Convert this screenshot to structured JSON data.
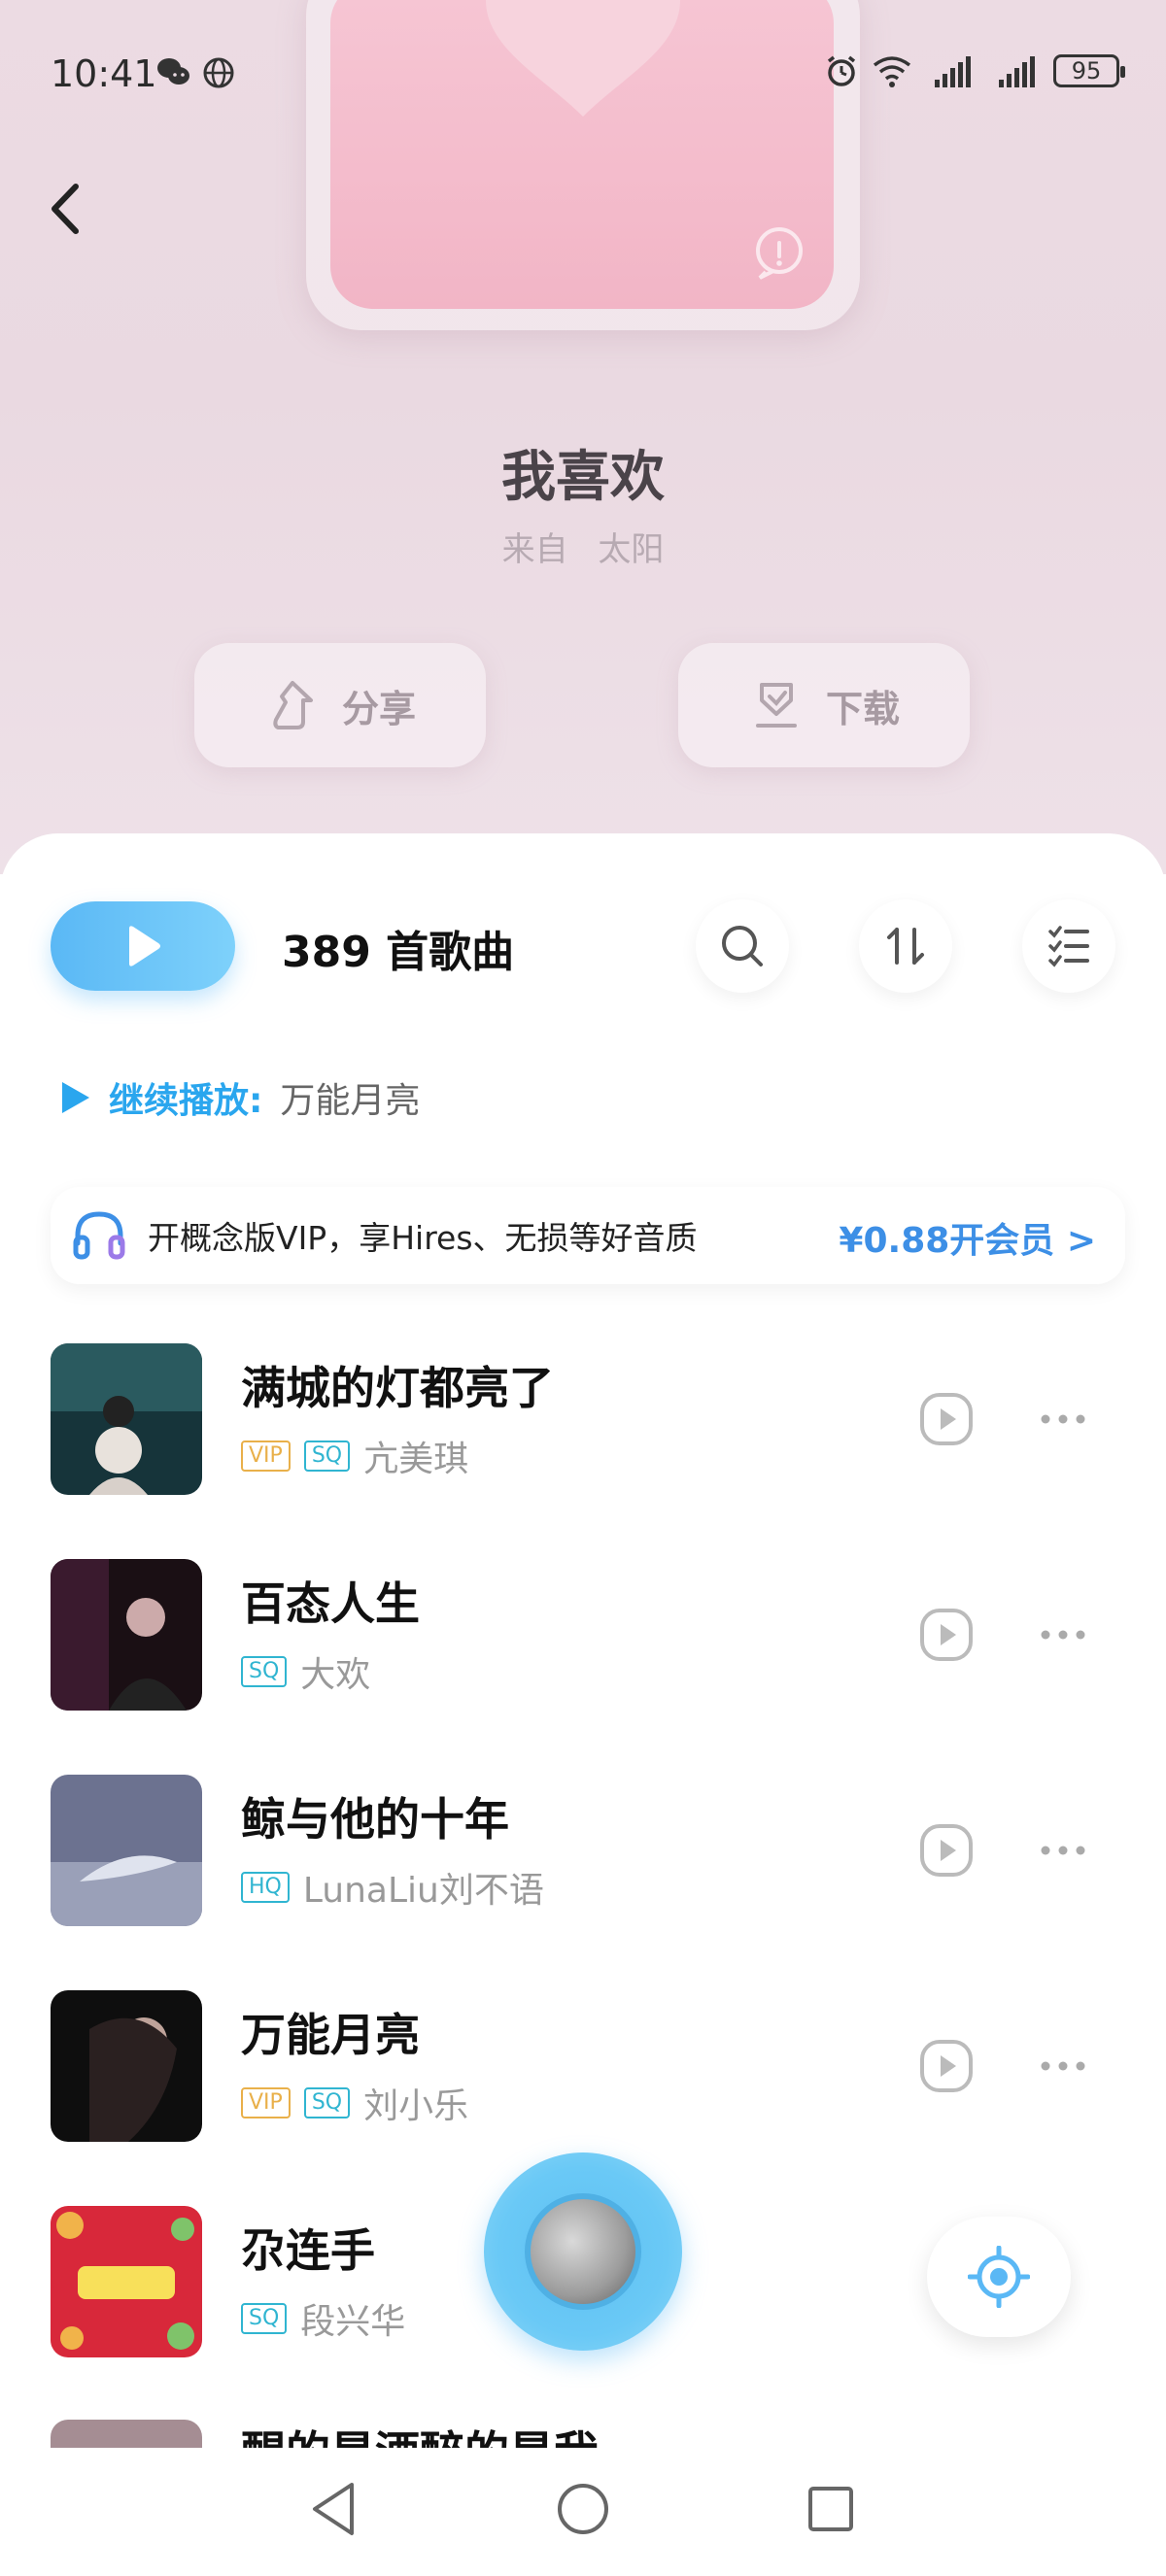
{
  "status": {
    "time": "10:41",
    "battery": "95"
  },
  "playlist": {
    "title": "我喜欢",
    "from_label": "来自",
    "owner": "太阳",
    "share_label": "分享",
    "download_label": "下载"
  },
  "list_header": {
    "song_count": "389 首歌曲"
  },
  "continue": {
    "label": "继续播放:",
    "song": "万能月亮"
  },
  "vip_banner": {
    "text": "开概念版VIP，享Hires、无损等好音质",
    "cta": "¥0.88开会员 >"
  },
  "songs": [
    {
      "title": "满城的灯都亮了",
      "tags": [
        "VIP",
        "SQ"
      ],
      "artist": "亢美琪"
    },
    {
      "title": "百态人生",
      "tags": [
        "SQ"
      ],
      "artist": "大欢"
    },
    {
      "title": "鲸与他的十年",
      "tags": [
        "HQ"
      ],
      "artist": "LunaLiu刘不语"
    },
    {
      "title": "万能月亮",
      "tags": [
        "VIP",
        "SQ"
      ],
      "artist": "刘小乐"
    },
    {
      "title": "尕连手",
      "tags": [
        "SQ"
      ],
      "artist": "段兴华"
    }
  ],
  "partial_song_title": "醒的是酒醉的是我",
  "colors": {
    "accent": "#2aa6ee",
    "vip_cta": "#3d8fe6",
    "tag_vip": "#e9b04a",
    "tag_sq": "#30b5d1"
  }
}
